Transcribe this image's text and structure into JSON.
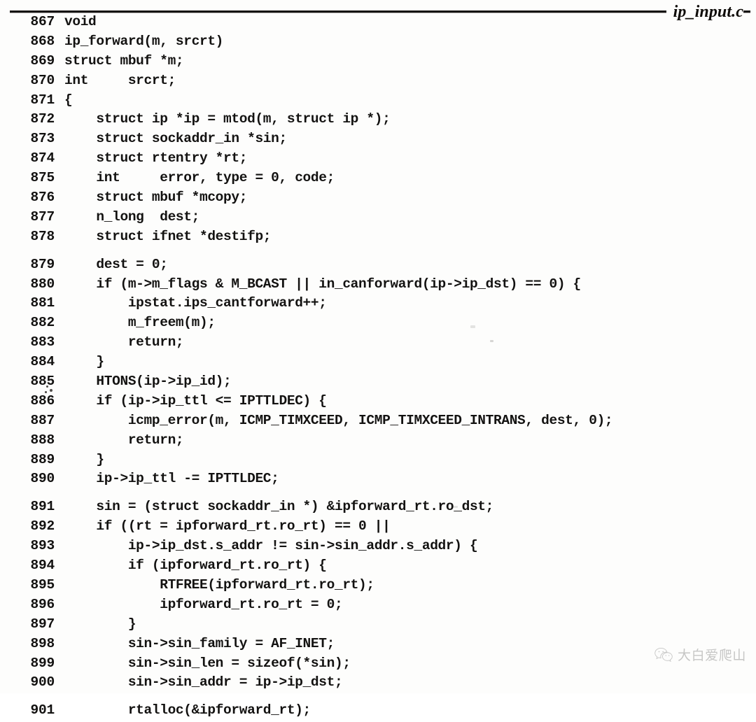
{
  "header": {
    "filename": "ip_input.c"
  },
  "listing": {
    "lines": [
      {
        "no": "867",
        "text": "void",
        "gap_before": false
      },
      {
        "no": "868",
        "text": "ip_forward(m, srcrt)",
        "gap_before": false
      },
      {
        "no": "869",
        "text": "struct mbuf *m;",
        "gap_before": false
      },
      {
        "no": "870",
        "text": "int     srcrt;",
        "gap_before": false
      },
      {
        "no": "871",
        "text": "{",
        "gap_before": false
      },
      {
        "no": "872",
        "text": "    struct ip *ip = mtod(m, struct ip *);",
        "gap_before": false
      },
      {
        "no": "873",
        "text": "    struct sockaddr_in *sin;",
        "gap_before": false
      },
      {
        "no": "874",
        "text": "    struct rtentry *rt;",
        "gap_before": false
      },
      {
        "no": "875",
        "text": "    int     error, type = 0, code;",
        "gap_before": false
      },
      {
        "no": "876",
        "text": "    struct mbuf *mcopy;",
        "gap_before": false
      },
      {
        "no": "877",
        "text": "    n_long  dest;",
        "gap_before": false
      },
      {
        "no": "878",
        "text": "    struct ifnet *destifp;",
        "gap_before": false
      },
      {
        "no": "879",
        "text": "    dest = 0;",
        "gap_before": true
      },
      {
        "no": "880",
        "text": "    if (m->m_flags & M_BCAST || in_canforward(ip->ip_dst) == 0) {",
        "gap_before": false
      },
      {
        "no": "881",
        "text": "        ipstat.ips_cantforward++;",
        "gap_before": false
      },
      {
        "no": "882",
        "text": "        m_freem(m);",
        "gap_before": false
      },
      {
        "no": "883",
        "text": "        return;",
        "gap_before": false
      },
      {
        "no": "884",
        "text": "    }",
        "gap_before": false
      },
      {
        "no": "885",
        "text": "    HTONS(ip->ip_id);",
        "gap_before": false
      },
      {
        "no": "886",
        "text": "    if (ip->ip_ttl <= IPTTLDEC) {",
        "gap_before": false
      },
      {
        "no": "887",
        "text": "        icmp_error(m, ICMP_TIMXCEED, ICMP_TIMXCEED_INTRANS, dest, 0);",
        "gap_before": false
      },
      {
        "no": "888",
        "text": "        return;",
        "gap_before": false
      },
      {
        "no": "889",
        "text": "    }",
        "gap_before": false
      },
      {
        "no": "890",
        "text": "    ip->ip_ttl -= IPTTLDEC;",
        "gap_before": false
      },
      {
        "no": "891",
        "text": "    sin = (struct sockaddr_in *) &ipforward_rt.ro_dst;",
        "gap_before": true
      },
      {
        "no": "892",
        "text": "    if ((rt = ipforward_rt.ro_rt) == 0 ||",
        "gap_before": false
      },
      {
        "no": "893",
        "text": "        ip->ip_dst.s_addr != sin->sin_addr.s_addr) {",
        "gap_before": false
      },
      {
        "no": "894",
        "text": "        if (ipforward_rt.ro_rt) {",
        "gap_before": false
      },
      {
        "no": "895",
        "text": "            RTFREE(ipforward_rt.ro_rt);",
        "gap_before": false
      },
      {
        "no": "896",
        "text": "            ipforward_rt.ro_rt = 0;",
        "gap_before": false
      },
      {
        "no": "897",
        "text": "        }",
        "gap_before": false
      },
      {
        "no": "898",
        "text": "        sin->sin_family = AF_INET;",
        "gap_before": false
      },
      {
        "no": "899",
        "text": "        sin->sin_len = sizeof(*sin);",
        "gap_before": false
      },
      {
        "no": "900",
        "text": "        sin->sin_addr = ip->ip_dst;",
        "gap_before": false
      },
      {
        "no": "901",
        "text": "        rtalloc(&ipforward_rt);",
        "gap_before": true
      }
    ]
  },
  "watermark": {
    "text": "大白爱爬山",
    "logo_icon": "wechat-icon"
  }
}
